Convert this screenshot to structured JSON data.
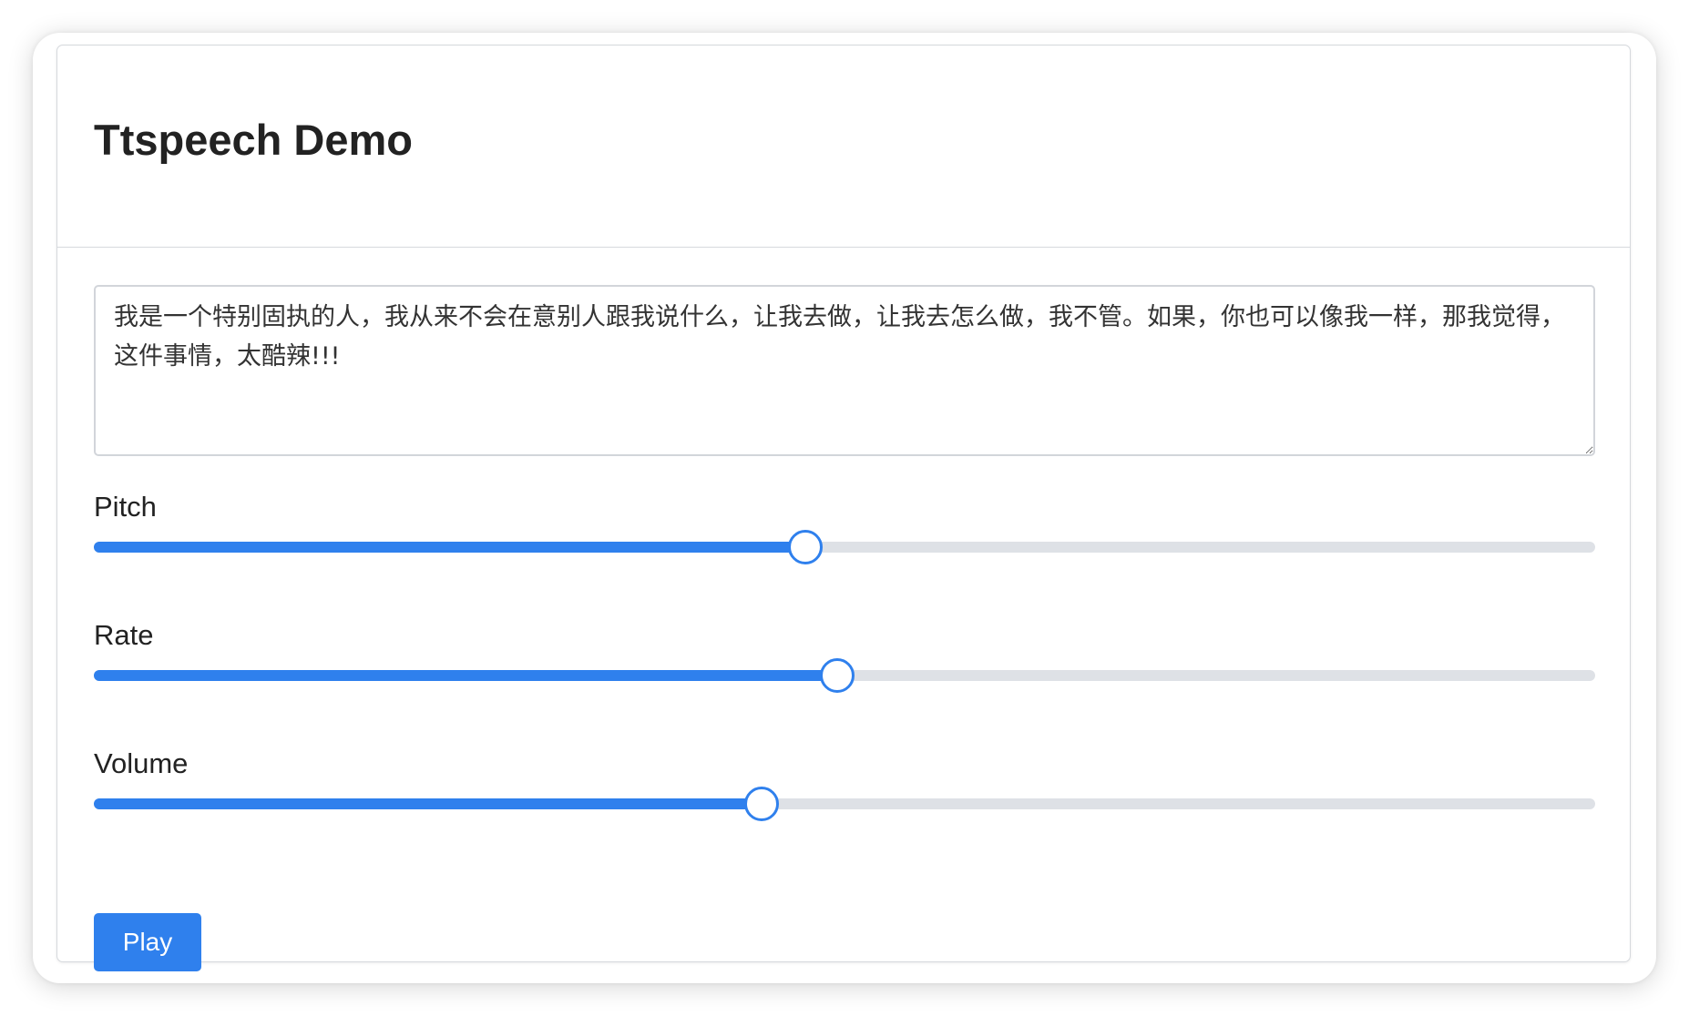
{
  "page": {
    "title": "Ttspeech Demo"
  },
  "speech": {
    "text": "我是一个特别固执的人，我从来不会在意别人跟我说什么，让我去做，让我去怎么做，我不管。如果，你也可以像我一样，那我觉得，这件事情，太酷辣!!!"
  },
  "sliders": [
    {
      "label": "Pitch",
      "value_fraction": 0.474
    },
    {
      "label": "Rate",
      "value_fraction": 0.495
    },
    {
      "label": "Volume",
      "value_fraction": 0.445
    }
  ],
  "actions": {
    "play_label": "Play"
  },
  "colors": {
    "accent": "#2f80ed",
    "track": "#dee1e6",
    "border": "#d6d9dd",
    "text": "#222222"
  }
}
